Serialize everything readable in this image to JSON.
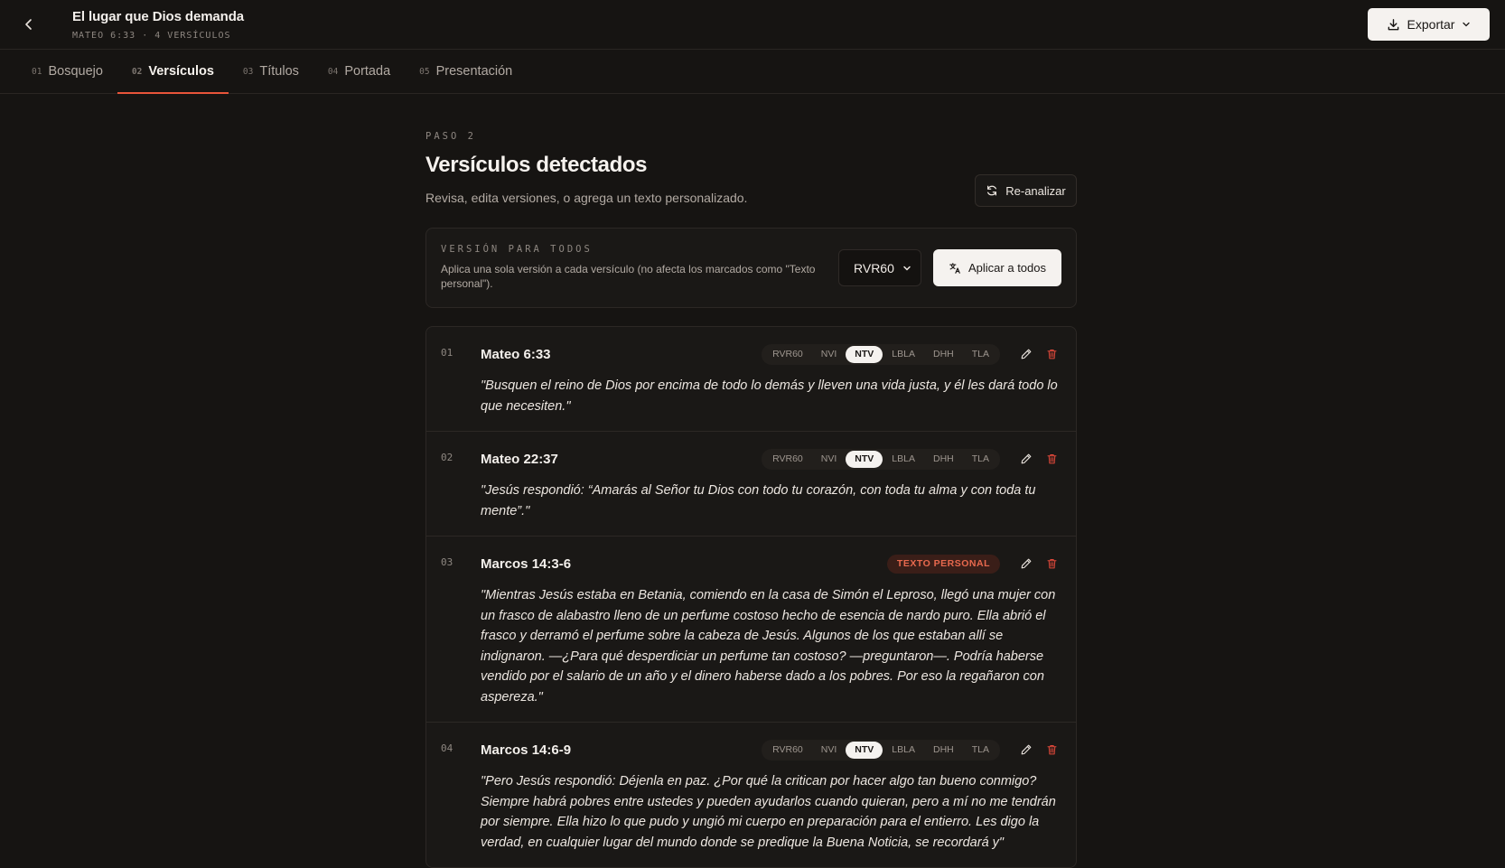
{
  "header": {
    "title": "El lugar que Dios demanda",
    "subtitle": "MATEO 6:33 · 4 VERSÍCULOS",
    "export_label": "Exportar"
  },
  "tabs": [
    {
      "num": "01",
      "label": "Bosquejo",
      "active": false
    },
    {
      "num": "02",
      "label": "Versículos",
      "active": true
    },
    {
      "num": "03",
      "label": "Títulos",
      "active": false
    },
    {
      "num": "04",
      "label": "Portada",
      "active": false
    },
    {
      "num": "05",
      "label": "Presentación",
      "active": false
    }
  ],
  "main": {
    "step": "PASO 2",
    "title": "Versículos detectados",
    "description": "Revisa, edita versiones, o agrega un texto personalizado.",
    "reanalyze_label": "Re-analizar"
  },
  "version_card": {
    "label": "VERSIÓN PARA TODOS",
    "description": "Aplica una sola versión a cada versículo (no afecta los marcados como \"Texto personal\").",
    "selected": "RVR60",
    "apply_label": "Aplicar a todos"
  },
  "versions": [
    "RVR60",
    "NVI",
    "NTV",
    "LBLA",
    "DHH",
    "TLA"
  ],
  "verses": [
    {
      "num": "01",
      "ref": "Mateo 6:33",
      "selected": "NTV",
      "badge": "",
      "text": "\"Busquen el reino de Dios por encima de todo lo demás y lleven una vida justa, y él les dará todo lo que necesiten.\""
    },
    {
      "num": "02",
      "ref": "Mateo 22:37",
      "selected": "NTV",
      "badge": "",
      "text": "\"Jesús respondió: “Amarás al Señor tu Dios con todo tu corazón, con toda tu alma y con toda tu mente”.\""
    },
    {
      "num": "03",
      "ref": "Marcos 14:3-6",
      "selected": "",
      "badge": "TEXTO PERSONAL",
      "text": "\"Mientras Jesús estaba en Betania, comiendo en la casa de Simón el Leproso, llegó una mujer con un frasco de alabastro lleno de un perfume costoso hecho de esencia de nardo puro. Ella abrió el frasco y derramó el perfume sobre la cabeza de Jesús. Algunos de los que estaban allí se indignaron. —¿Para qué desperdiciar un perfume tan costoso? —preguntaron—. Podría haberse vendido por el salario de un año y el dinero haberse dado a los pobres. Por eso la regañaron con aspereza.\""
    },
    {
      "num": "04",
      "ref": "Marcos 14:6-9",
      "selected": "NTV",
      "badge": "",
      "text": "\"Pero Jesús respondió: Déjenla en paz. ¿Por qué la critican por hacer algo tan bueno conmigo? Siempre habrá pobres entre ustedes y pueden ayudarlos cuando quieran, pero a mí no me tendrán por siempre. Ella hizo lo que pudo y ungió mi cuerpo en preparación para el entierro. Les digo la verdad, en cualquier lugar del mundo donde se predique la Buena Noticia, se recordará y\""
    }
  ],
  "colors": {
    "background": "#161412",
    "accent": "#e8553a",
    "delete": "#e0483a"
  }
}
